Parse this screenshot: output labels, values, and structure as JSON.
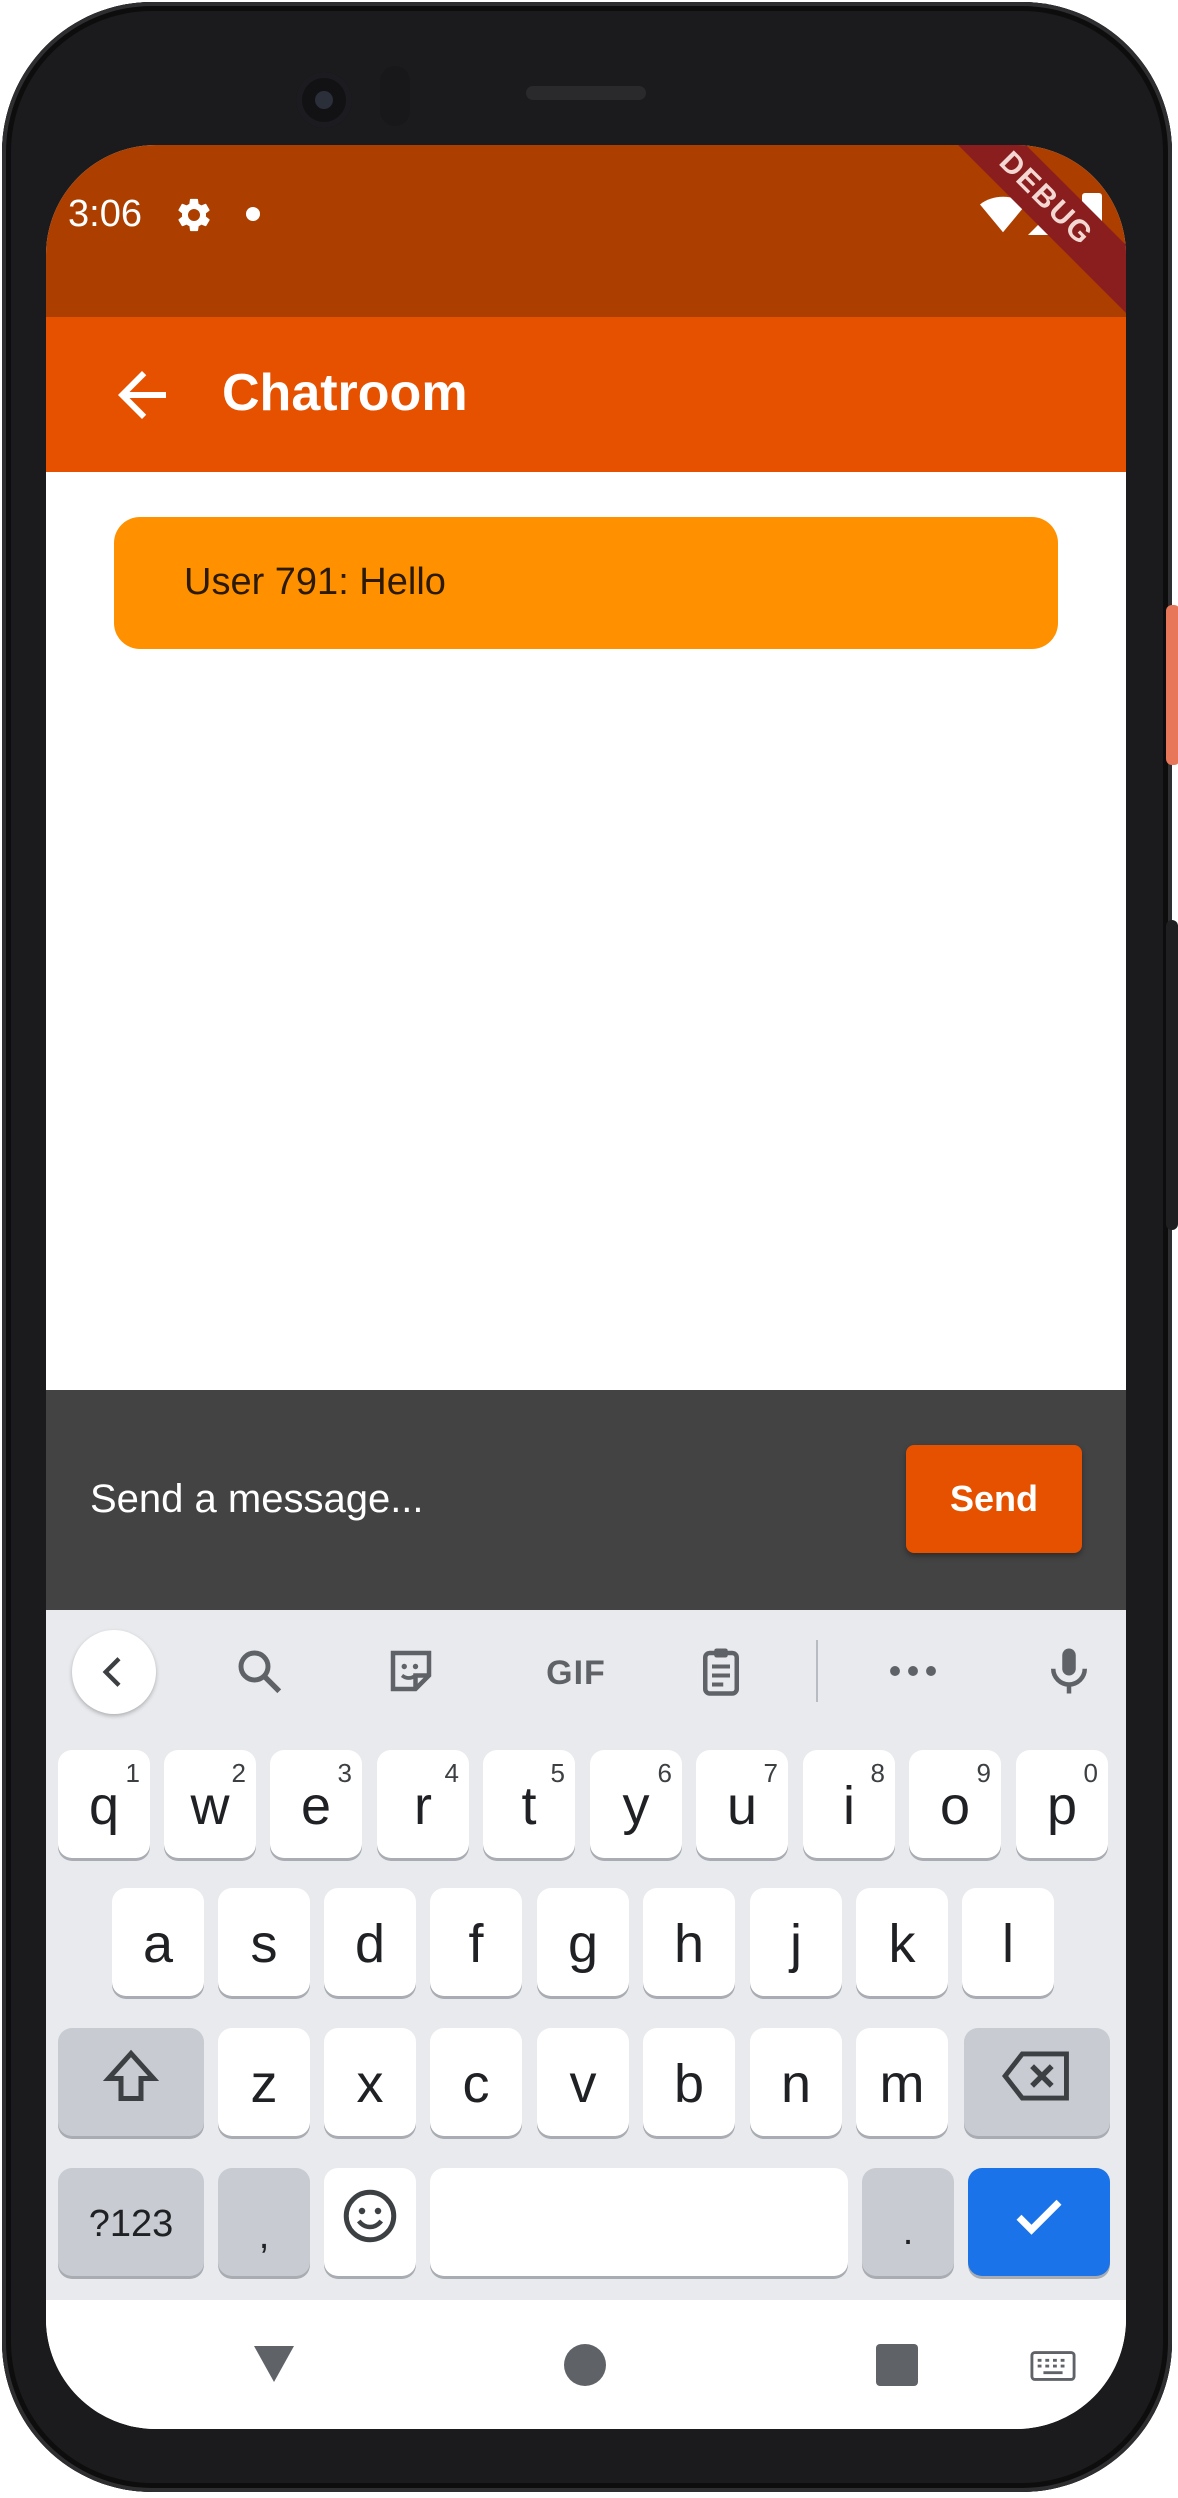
{
  "status_bar": {
    "time": "3:06",
    "debug_label": "DEBUG"
  },
  "app_bar": {
    "title": "Chatroom"
  },
  "messages": [
    {
      "text": "User 791: Hello"
    }
  ],
  "composer": {
    "placeholder": "Send a message...",
    "send_label": "Send"
  },
  "keyboard": {
    "toolbar": [
      "collapse",
      "search",
      "sticker",
      "GIF",
      "clipboard",
      "more",
      "microphone"
    ],
    "gif_label": "GIF",
    "row1": [
      {
        "key": "q",
        "hint": "1"
      },
      {
        "key": "w",
        "hint": "2"
      },
      {
        "key": "e",
        "hint": "3"
      },
      {
        "key": "r",
        "hint": "4"
      },
      {
        "key": "t",
        "hint": "5"
      },
      {
        "key": "y",
        "hint": "6"
      },
      {
        "key": "u",
        "hint": "7"
      },
      {
        "key": "i",
        "hint": "8"
      },
      {
        "key": "o",
        "hint": "9"
      },
      {
        "key": "p",
        "hint": "0"
      }
    ],
    "row2": [
      "a",
      "s",
      "d",
      "f",
      "g",
      "h",
      "j",
      "k",
      "l"
    ],
    "row3": [
      "z",
      "x",
      "c",
      "v",
      "b",
      "n",
      "m"
    ],
    "symbols_label": "?123",
    "comma_label": ",",
    "period_label": "."
  },
  "colors": {
    "status_bar": "#ac3e00",
    "app_bar": "#e65100",
    "message_bubble": "#ff9100",
    "composer": "#434343",
    "keyboard_bg": "#e8eaed",
    "enter_key": "#1a73e8"
  }
}
